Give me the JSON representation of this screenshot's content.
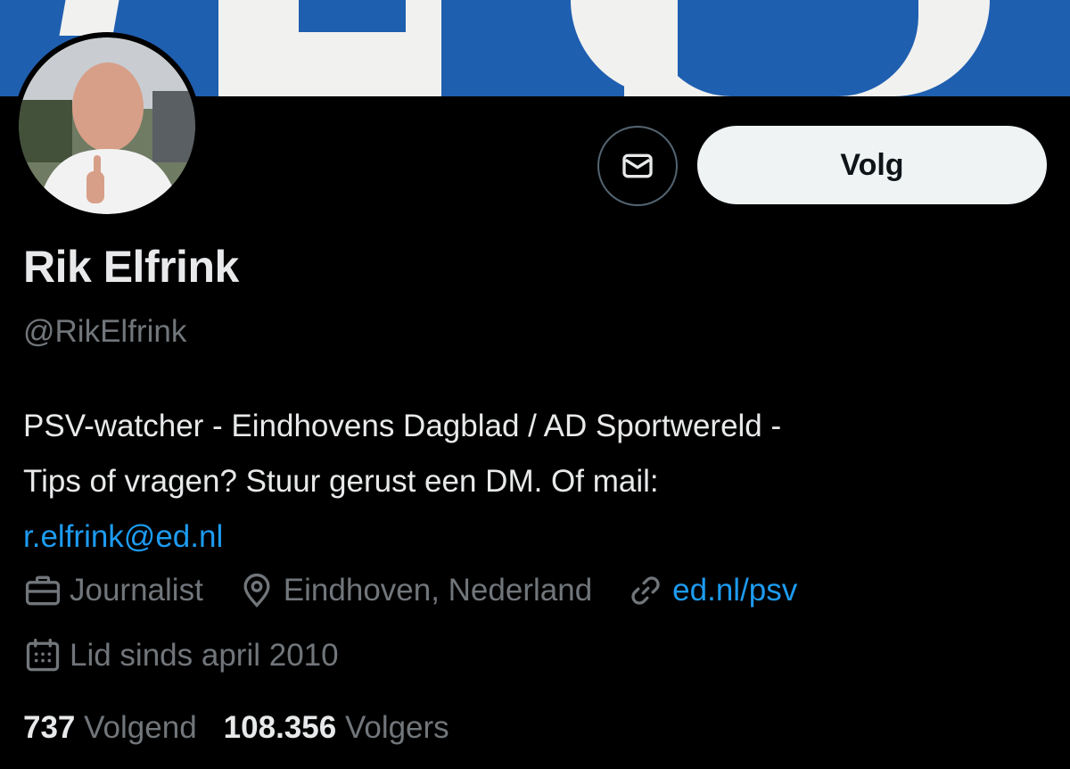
{
  "profile": {
    "name": "Rik Elfrink",
    "handle": "@RikElfrink",
    "bio": {
      "line1": "PSV-watcher - Eindhovens Dagblad / AD Sportwereld -",
      "line2": "Tips of vragen? Stuur gerust een DM. Of mail:",
      "email": "r.elfrink@ed.nl"
    },
    "meta": {
      "profession": "Journalist",
      "location": "Eindhoven, Nederland",
      "website": "ed.nl/psv",
      "joined": "Lid sinds april 2010"
    },
    "stats": {
      "following_count": "737",
      "following_label": "Volgend",
      "followers_count": "108.356",
      "followers_label": "Volgers"
    }
  },
  "actions": {
    "follow_label": "Volg",
    "message_icon": "envelope-icon"
  },
  "icons": {
    "profession": "briefcase-icon",
    "location": "location-pin-icon",
    "website": "link-icon",
    "joined": "calendar-icon"
  },
  "colors": {
    "background": "#000000",
    "banner_blue": "#1f5fb0",
    "text_primary": "#e7e9ea",
    "text_secondary": "#71767b",
    "link": "#1d9bf0",
    "follow_button_bg": "#eff3f4"
  }
}
